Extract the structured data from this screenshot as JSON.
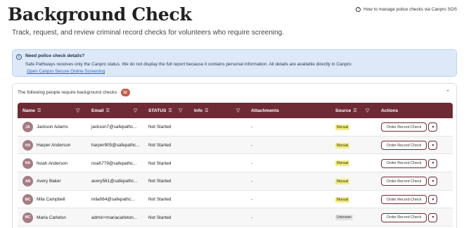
{
  "page": {
    "title": "Background Check",
    "subtitle": "Track, request, and review criminal record checks for volunteers who require screening.",
    "help_link": "How to manage police checks via Canpro SOS"
  },
  "alert": {
    "title": "Need police check details?",
    "body": "Safe Pathways receives only the Canpro status. We do not display the full report because it contains personal information. All details are available directly in Canpro:",
    "link": "Open Canpro Secure Online Screening"
  },
  "panel": {
    "heading": "The following people require background checks",
    "count": "32"
  },
  "table": {
    "columns": {
      "name": "Name",
      "email": "Email",
      "status": "STATUS",
      "info": "Info",
      "attachments": "Attachments",
      "source": "Source",
      "actions": "Actions"
    },
    "rows": [
      {
        "initials": "JA",
        "name": "Jackson Adams",
        "email": "jackson7@safepathc...",
        "status": "Not Started",
        "attachments": "-",
        "source": "Manual",
        "action": "Order Record Check"
      },
      {
        "initials": "HA",
        "name": "Harper Anderson",
        "email": "harper905@safepathc...",
        "status": "Not Started",
        "attachments": "-",
        "source": "Manual",
        "action": "Order Record Check"
      },
      {
        "initials": "NA",
        "name": "Noah Anderson",
        "email": "noah779@safepathc...",
        "status": "Not Started",
        "attachments": "-",
        "source": "Manual",
        "action": "Order Record Check"
      },
      {
        "initials": "AB",
        "name": "Avery Baker",
        "email": "avery561@safepathc...",
        "status": "Not Started",
        "attachments": "-",
        "source": "Manual",
        "action": "Order Record Check"
      },
      {
        "initials": "MC",
        "name": "Mila Campbell",
        "email": "mila064@safepathc...",
        "status": "Not Started",
        "attachments": "-",
        "source": "Manual",
        "action": "Order Record Check"
      },
      {
        "initials": "MC",
        "name": "Maria Carleton",
        "email": "admin+mariacarleton...",
        "status": "Not Started",
        "attachments": "-",
        "source": "Unknown",
        "action": "Order Record Check"
      }
    ]
  },
  "colors": {
    "header_bg": "#6e2b35",
    "badge": "#c45a4a",
    "avatar": "#a57b84",
    "manual_tag": "#f2ec7c",
    "alert_bg": "#dde9f8"
  },
  "icons": [
    "question-circle-icon",
    "info-icon",
    "sort-icon",
    "filter-icon",
    "chevron-up-icon",
    "chevron-down-icon"
  ]
}
